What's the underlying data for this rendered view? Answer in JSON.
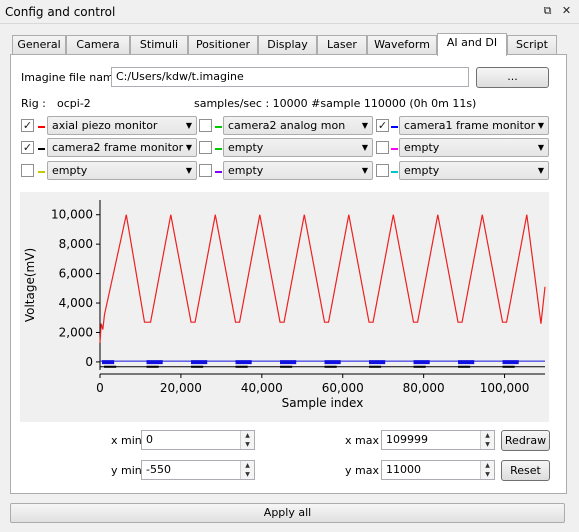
{
  "window": {
    "title": "Config and control"
  },
  "tabs": [
    {
      "label": "General",
      "active": false
    },
    {
      "label": "Camera",
      "active": false
    },
    {
      "label": "Stimuli",
      "active": false
    },
    {
      "label": "Positioner",
      "active": false
    },
    {
      "label": "Display",
      "active": false
    },
    {
      "label": "Laser",
      "active": false
    },
    {
      "label": "Waveform",
      "active": false
    },
    {
      "label": "AI and DI",
      "active": true
    },
    {
      "label": "Script",
      "active": false
    }
  ],
  "file": {
    "label": "Imagine file name",
    "value": "C:/Users/kdw/t.imagine",
    "browse": "..."
  },
  "rig": {
    "label": "Rig :",
    "value": "ocpi-2"
  },
  "samples": {
    "text": "samples/sec :  10000  #sample  110000 (0h 0m 11s)"
  },
  "channels": [
    {
      "checked": true,
      "color": "#ff0000",
      "value": "axial piezo monitor"
    },
    {
      "checked": false,
      "color": "#00c800",
      "value": "camera2 analog mon"
    },
    {
      "checked": true,
      "color": "#0000ff",
      "value": "camera1 frame monitor"
    },
    {
      "checked": true,
      "color": "#000000",
      "value": "camera2 frame monitor"
    },
    {
      "checked": false,
      "color": "#00c800",
      "value": "empty"
    },
    {
      "checked": false,
      "color": "#ff00ff",
      "value": "empty"
    },
    {
      "checked": false,
      "color": "#c8c800",
      "value": "empty"
    },
    {
      "checked": false,
      "color": "#8000ff",
      "value": "empty"
    },
    {
      "checked": false,
      "color": "#00c8c8",
      "value": "empty"
    }
  ],
  "chart_data": {
    "type": "line",
    "xlabel": "Sample index",
    "ylabel": "Voltage(mV)",
    "xlim": [
      0,
      109999
    ],
    "ylim": [
      -550,
      11000
    ],
    "xticks": [
      0,
      20000,
      40000,
      60000,
      80000,
      100000
    ],
    "xtick_labels": [
      "0",
      "20,000",
      "40,000",
      "60,000",
      "80,000",
      "100,000"
    ],
    "yticks": [
      0,
      2000,
      4000,
      6000,
      8000,
      10000
    ],
    "ytick_labels": [
      "0",
      "2,000",
      "4,000",
      "6,000",
      "8,000",
      "10,000"
    ],
    "series": [
      {
        "color": "#ee2020",
        "x": [
          0,
          300,
          700,
          1100,
          6500,
          11000,
          12500,
          17500,
          22500,
          23500,
          28500,
          33500,
          34500,
          39500,
          44500,
          45500,
          50500,
          55500,
          56500,
          61500,
          66500,
          67500,
          72500,
          77500,
          78500,
          83500,
          88500,
          89500,
          94500,
          99500,
          100500,
          105500,
          109000,
          110000
        ],
        "y": [
          1300,
          2600,
          2200,
          3200,
          10000,
          2700,
          2700,
          10000,
          2700,
          2700,
          10000,
          2700,
          2700,
          10000,
          2700,
          2700,
          10000,
          2700,
          2700,
          10000,
          2700,
          2700,
          10000,
          2700,
          2700,
          10000,
          2700,
          2700,
          10000,
          2700,
          2700,
          10000,
          2600,
          5100
        ]
      },
      {
        "color": "#1010e0",
        "x": [
          0,
          110000
        ],
        "y": [
          0,
          0
        ],
        "pulse_level": 50,
        "pulse_y": [
          -150,
          120
        ],
        "pulse_x": [
          500,
          3500,
          11500,
          15500,
          22500,
          26500,
          33500,
          37500,
          44500,
          48500,
          55500,
          59500,
          66500,
          70500,
          77500,
          81500,
          88500,
          92500,
          99500,
          103500
        ]
      },
      {
        "color": "#000000",
        "x": [
          0,
          110000
        ],
        "y": [
          -330,
          -330
        ],
        "pulse_level": -330,
        "pulse_y": [
          -400,
          -260
        ],
        "pulse_x": [
          1000,
          4000,
          11500,
          14500,
          22500,
          25500,
          33500,
          36500,
          44500,
          47500,
          55500,
          58500,
          66500,
          69500,
          77500,
          80500,
          88500,
          91500,
          99500,
          102500
        ]
      }
    ]
  },
  "controls": {
    "xmin_label": "x min",
    "xmin": "0",
    "ymin_label": "y min",
    "ymin": "-550",
    "xmax_label": "x max",
    "xmax": "109999",
    "ymax_label": "y max",
    "ymax": "11000",
    "redraw": "Redraw",
    "reset": "Reset"
  },
  "apply_all": "Apply all"
}
